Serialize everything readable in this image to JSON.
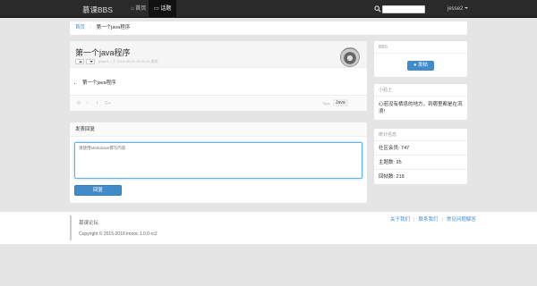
{
  "navbar": {
    "brand": "慕课BBS",
    "home_label": "首页",
    "topics_label": "话题",
    "search_placeholder": "",
    "user": "jesse2"
  },
  "breadcrumb": {
    "home": "首页",
    "current": "第一个java程序"
  },
  "topic": {
    "title": "第一个java程序",
    "meta": "jesse1 • 于 2016-06-25 15:32:34 发帖",
    "body_items": [
      "第一个java程序"
    ],
    "tag_label": "Tags:",
    "tag": "Java"
  },
  "reply": {
    "heading": "发表回复",
    "placeholder": "请使用Markdown撰写内容",
    "button": "回复"
  },
  "sidebar": {
    "bbs_heading": "BBS",
    "post_button": "发帖",
    "tips_heading": "小贴士",
    "tips_text": "心若没有栖息的地方，到哪里都是在流浪!",
    "stats_heading": "统计信息",
    "members": "社区会员: 747",
    "topics": "主题数: 95",
    "replies": "回帖数: 218"
  },
  "footer": {
    "title": "慕课论坛",
    "copyright": "Copyright © 2015-2016 imooc 1.0.0-rc2",
    "link_about": "关于我们",
    "link_contact": "联系我们",
    "link_faq": "常见问题解答"
  },
  "colors": {
    "primary": "#428bca",
    "navbar": "#2a2a2a"
  }
}
